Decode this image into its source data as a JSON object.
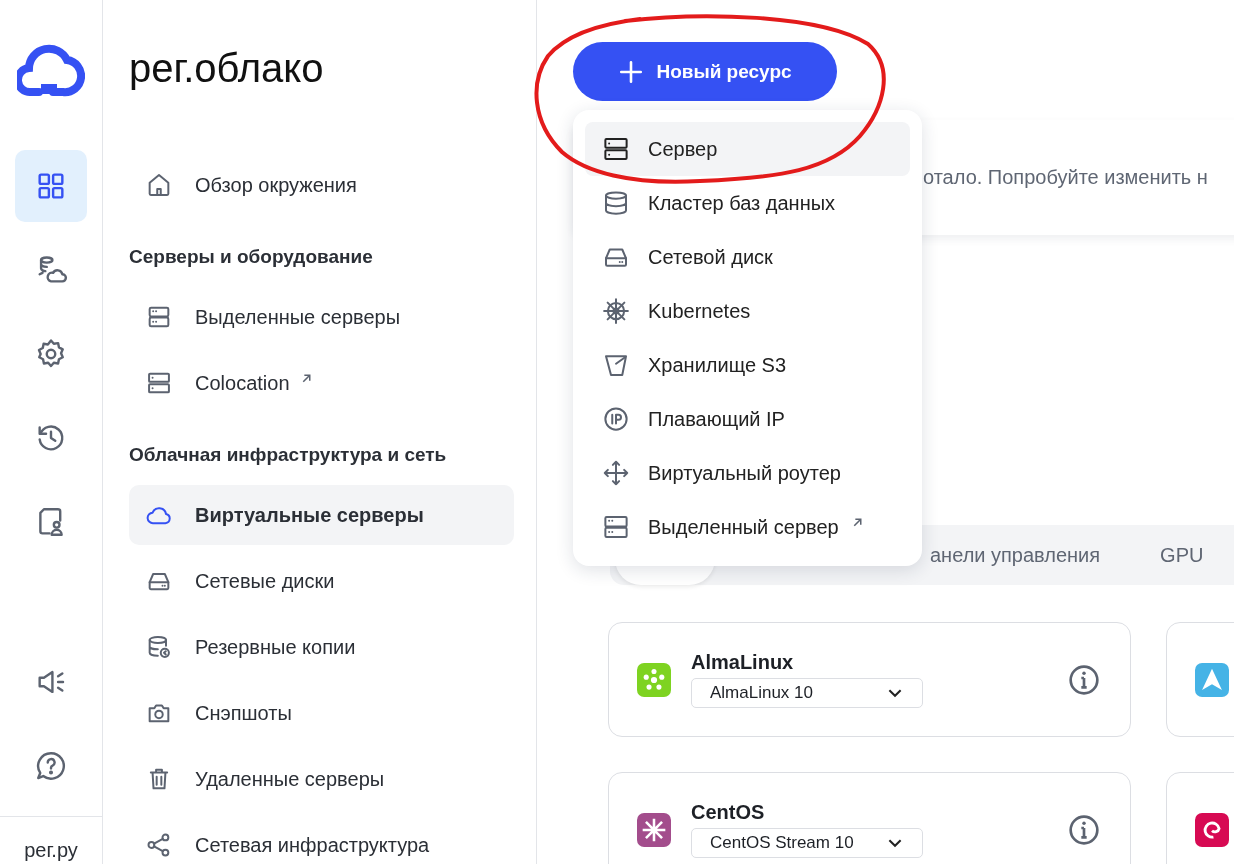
{
  "rail": {
    "items": [
      {
        "selected": true
      },
      {
        "selected": false
      },
      {
        "selected": false
      },
      {
        "selected": false
      },
      {
        "selected": false
      },
      {
        "selected": false
      },
      {
        "selected": false
      }
    ],
    "footer": "рег.ру"
  },
  "brand": "рег.облако",
  "sidebar": {
    "items": [
      {
        "kind": "item",
        "label": "Обзор окружения",
        "selected": false,
        "external": false
      },
      {
        "kind": "heading",
        "label": "Серверы и оборудование"
      },
      {
        "kind": "item",
        "label": "Выделенные серверы",
        "selected": false,
        "external": false
      },
      {
        "kind": "item",
        "label": "Colocation",
        "selected": false,
        "external": true
      },
      {
        "kind": "heading",
        "label": "Облачная инфраструктура и сеть"
      },
      {
        "kind": "item",
        "label": "Виртуальные серверы",
        "selected": true,
        "external": false
      },
      {
        "kind": "item",
        "label": "Сетевые диски",
        "selected": false,
        "external": false
      },
      {
        "kind": "item",
        "label": "Резервные копии",
        "selected": false,
        "external": false
      },
      {
        "kind": "item",
        "label": "Снэпшоты",
        "selected": false,
        "external": false
      },
      {
        "kind": "item",
        "label": "Удаленные серверы",
        "selected": false,
        "external": false
      },
      {
        "kind": "item",
        "label": "Сетевая инфраструктура",
        "selected": false,
        "external": false
      }
    ]
  },
  "new_button": "Новый ресурс",
  "menu": {
    "items": [
      {
        "label": "Сервер",
        "highlighted": true,
        "external": false
      },
      {
        "label": "Кластер баз данных",
        "highlighted": false,
        "external": false
      },
      {
        "label": "Сетевой диск",
        "highlighted": false,
        "external": false
      },
      {
        "label": "Kubernetes",
        "highlighted": false,
        "external": false
      },
      {
        "label": "Хранилище S3",
        "highlighted": false,
        "external": false
      },
      {
        "label": "Плавающий IP",
        "highlighted": false,
        "external": false
      },
      {
        "label": "Виртуальный роутер",
        "highlighted": false,
        "external": false
      },
      {
        "label": "Выделенный сервер",
        "highlighted": false,
        "external": true
      }
    ]
  },
  "notice": {
    "text": "отало. Попробуйте изменить н"
  },
  "tabs": [
    {
      "selected": true
    },
    {
      "label": "анели управления",
      "selected": false
    },
    {
      "label": "GPU",
      "selected": false
    }
  ],
  "os_cards": [
    {
      "name": "AlmaLinux",
      "version": "AlmaLinux 10",
      "color": "#7ed321"
    },
    {
      "color": "#45b3e6"
    },
    {
      "name": "CentOS",
      "version": "CentOS Stream 10",
      "color": "#a34d8c"
    },
    {
      "color": "#d70a53"
    }
  ]
}
